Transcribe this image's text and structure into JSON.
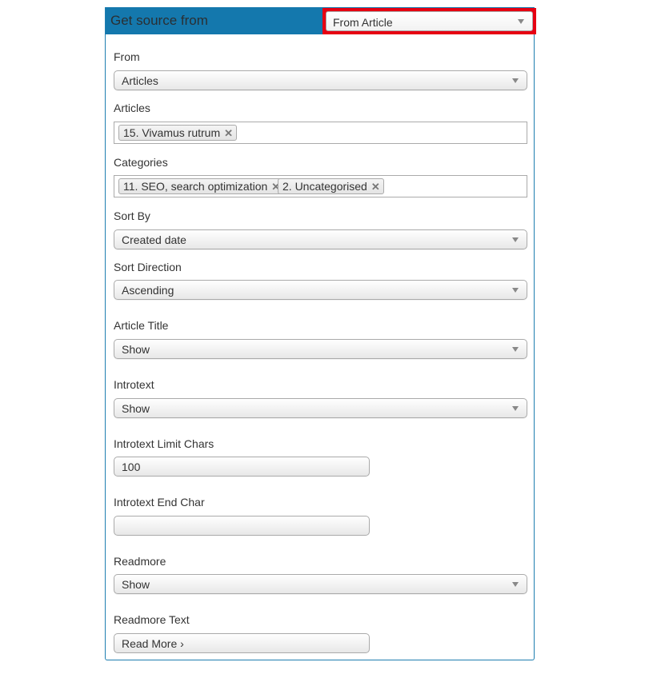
{
  "header": {
    "title": "Get source from",
    "source_select": {
      "value": "From Article"
    },
    "accent_color": "#1478ad",
    "highlight_color": "#e60012"
  },
  "fields": {
    "from": {
      "label": "From",
      "value": "Articles"
    },
    "articles": {
      "label": "Articles",
      "tags": [
        {
          "text": "15. Vivamus rutrum",
          "remove": "✕"
        }
      ]
    },
    "categories": {
      "label": "Categories",
      "tags": [
        {
          "text": "11. SEO, search optimization",
          "remove": "✕"
        },
        {
          "text": "2. Uncategorised",
          "remove": "✕"
        }
      ]
    },
    "sort_by": {
      "label": "Sort By",
      "value": "Created date"
    },
    "sort_direction": {
      "label": "Sort Direction",
      "value": "Ascending"
    },
    "article_title": {
      "label": "Article Title",
      "value": "Show"
    },
    "introtext": {
      "label": "Introtext",
      "value": "Show"
    },
    "introtext_limit_chars": {
      "label": "Introtext Limit Chars",
      "value": "100"
    },
    "introtext_end_char": {
      "label": "Introtext End Char",
      "value": ""
    },
    "readmore": {
      "label": "Readmore",
      "value": "Show"
    },
    "readmore_text": {
      "label": "Readmore Text",
      "value": "Read More ›"
    }
  }
}
